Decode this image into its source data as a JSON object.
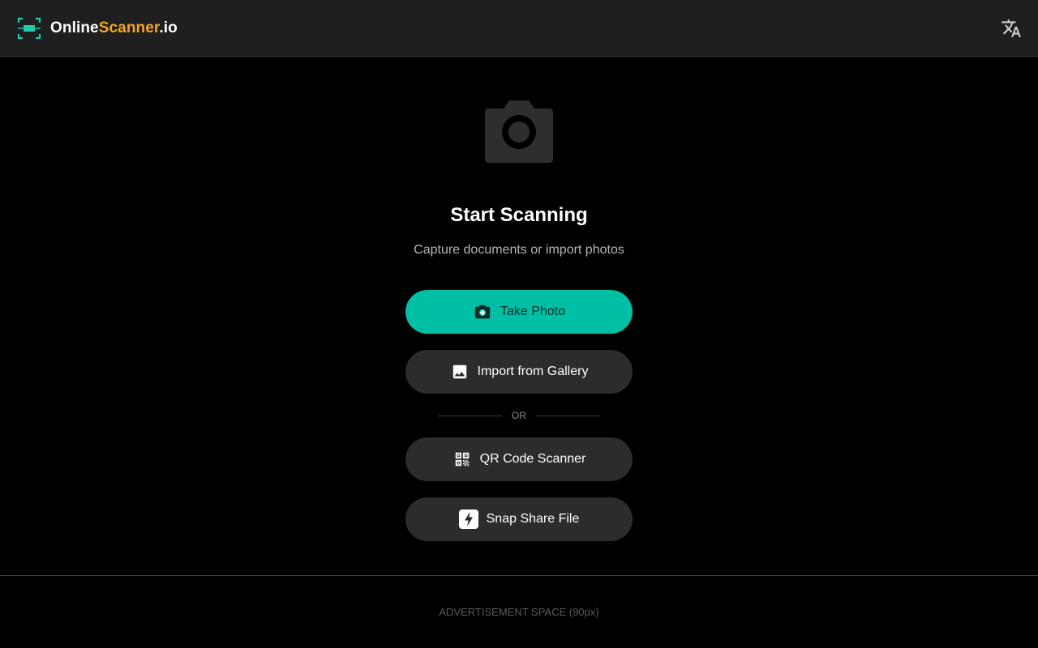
{
  "header": {
    "brand_part1": "Online",
    "brand_part2": "Scanner",
    "brand_part3": ".io",
    "logo_icon": "scan-frame-icon",
    "language_icon": "translate-icon"
  },
  "main": {
    "hero_icon": "camera-icon",
    "title": "Start Scanning",
    "subtitle": "Capture documents or import photos",
    "buttons": {
      "take_photo": "Take Photo",
      "import_gallery": "Import from Gallery",
      "divider": "OR",
      "qr_scanner": "QR Code Scanner",
      "snap_share": "Snap Share File"
    }
  },
  "footer": {
    "ad_text": "ADVERTISEMENT SPACE (90px)"
  },
  "colors": {
    "accent": "#00bfa5",
    "brand_orange": "#f5a623",
    "background": "#000000",
    "header_bg": "#1f1f1f",
    "button_bg": "#2c2c2c"
  }
}
